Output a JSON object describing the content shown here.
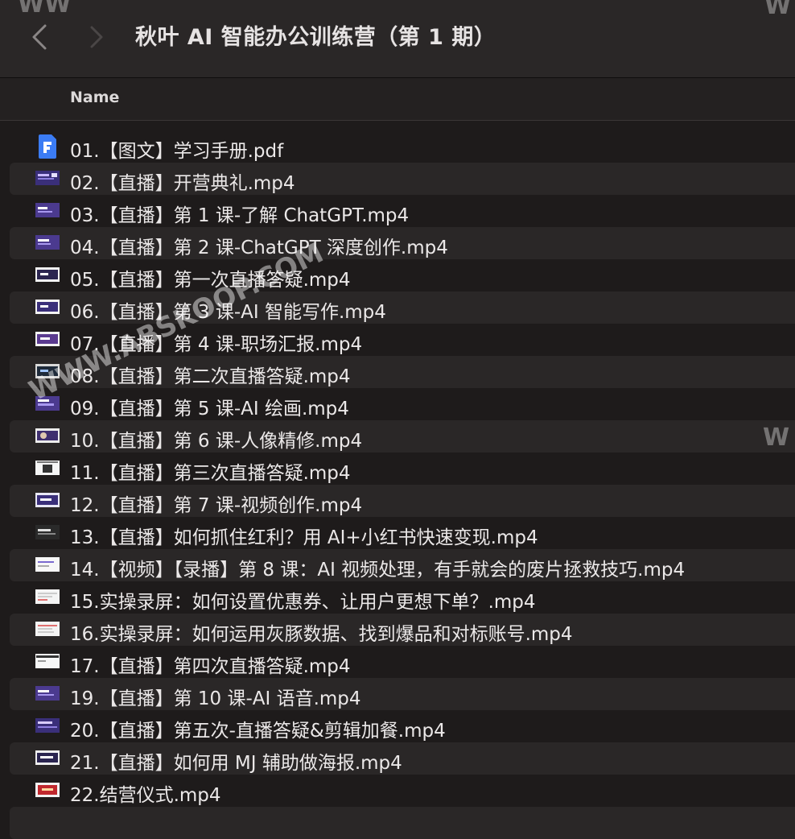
{
  "window": {
    "title": "秋叶 AI 智能办公训练营（第 1 期）",
    "back_icon": "chevron-left-icon",
    "forward_icon": "chevron-right-icon"
  },
  "columns": {
    "name": "Name"
  },
  "files": [
    {
      "name": "01.【图文】学习手册.pdf",
      "icon": "pdf-icon"
    },
    {
      "name": "02.【直播】开营典礼.mp4",
      "icon": "video-thumbnail"
    },
    {
      "name": "03.【直播】第 1 课-了解 ChatGPT.mp4",
      "icon": "video-thumbnail"
    },
    {
      "name": "04.【直播】第 2 课-ChatGPT 深度创作.mp4",
      "icon": "video-thumbnail"
    },
    {
      "name": "05.【直播】第一次直播答疑.mp4",
      "icon": "video-thumbnail"
    },
    {
      "name": "06.【直播】第 3 课-AI 智能写作.mp4",
      "icon": "video-thumbnail"
    },
    {
      "name": "07.【直播】第 4 课-职场汇报.mp4",
      "icon": "video-thumbnail"
    },
    {
      "name": "08.【直播】第二次直播答疑.mp4",
      "icon": "video-thumbnail"
    },
    {
      "name": "09.【直播】第 5 课-AI 绘画.mp4",
      "icon": "video-thumbnail"
    },
    {
      "name": "10.【直播】第 6 课-人像精修.mp4",
      "icon": "video-thumbnail"
    },
    {
      "name": "11.【直播】第三次直播答疑.mp4",
      "icon": "video-thumbnail"
    },
    {
      "name": "12.【直播】第 7 课-视频创作.mp4",
      "icon": "video-thumbnail"
    },
    {
      "name": "13.【直播】如何抓住红利？用 AI+小红书快速变现.mp4",
      "icon": "video-thumbnail"
    },
    {
      "name": "14.【视频】【录播】第 8 课：AI 视频处理，有手就会的废片拯救技巧.mp4",
      "icon": "video-thumbnail"
    },
    {
      "name": "15.实操录屏：如何设置优惠券、让用户更想下单？.mp4",
      "icon": "video-thumbnail"
    },
    {
      "name": "16.实操录屏：如何运用灰豚数据、找到爆品和对标账号.mp4",
      "icon": "video-thumbnail"
    },
    {
      "name": "17.【直播】第四次直播答疑.mp4",
      "icon": "video-thumbnail"
    },
    {
      "name": "19.【直播】第 10 课-AI 语音.mp4",
      "icon": "video-thumbnail"
    },
    {
      "name": "20.【直播】第五次-直播答疑&剪辑加餐.mp4",
      "icon": "video-thumbnail"
    },
    {
      "name": "21.【直播】如何用 MJ 辅助做海报.mp4",
      "icon": "video-thumbnail"
    },
    {
      "name": "22.结营仪式.mp4",
      "icon": "video-thumbnail"
    }
  ],
  "watermarks": {
    "main": "WWW.ABSKOOP.COM",
    "top_left": "WW",
    "top_right": "W",
    "mid_right": "W"
  },
  "colors": {
    "background": "#1e1b1b",
    "toolbar": "#2a2727",
    "row_alt": "#2a2727",
    "text": "#ebe8e8",
    "pdf_blue": "#3b7cf4"
  }
}
